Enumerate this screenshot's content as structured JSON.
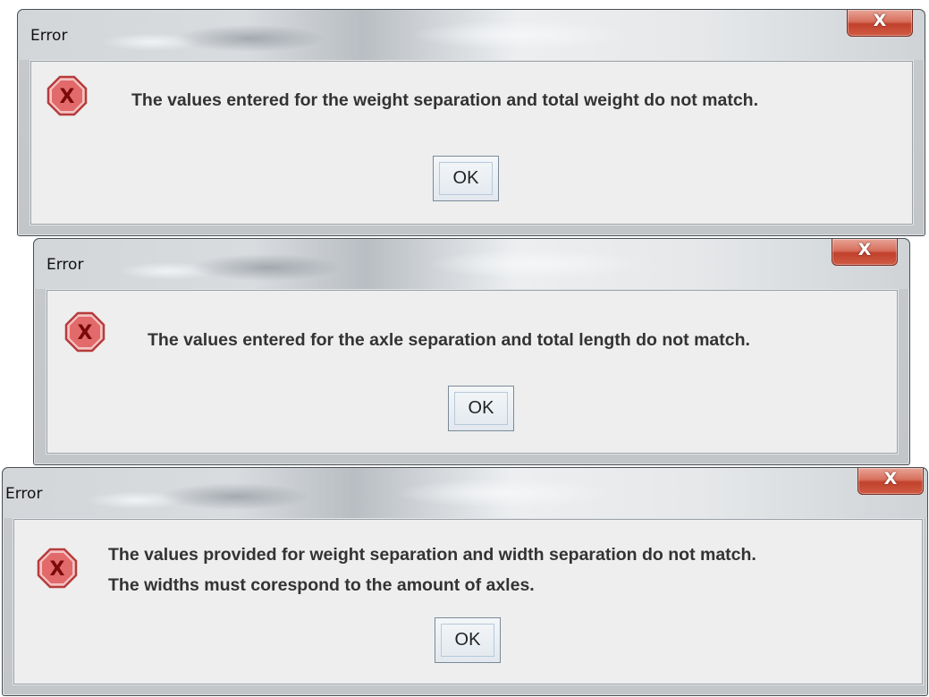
{
  "colors": {
    "close_button": "#c9442e",
    "dialog_body": "#eeeeee",
    "error_icon": "#e26a6a"
  },
  "dialogs": [
    {
      "title": "Error",
      "close_glyph": "X",
      "icon": "error-icon",
      "message_lines": [
        "The values entered for the weight separation and total weight do not match."
      ],
      "ok_label": "OK"
    },
    {
      "title": "Error",
      "close_glyph": "X",
      "icon": "error-icon",
      "message_lines": [
        "The values entered for the axle separation and total length do not match."
      ],
      "ok_label": "OK"
    },
    {
      "title": "Error",
      "close_glyph": "X",
      "icon": "error-icon",
      "message_lines": [
        "The values provided for weight separation and width separation do not match.",
        "The widths must corespond to the amount of axles."
      ],
      "ok_label": "OK"
    }
  ]
}
